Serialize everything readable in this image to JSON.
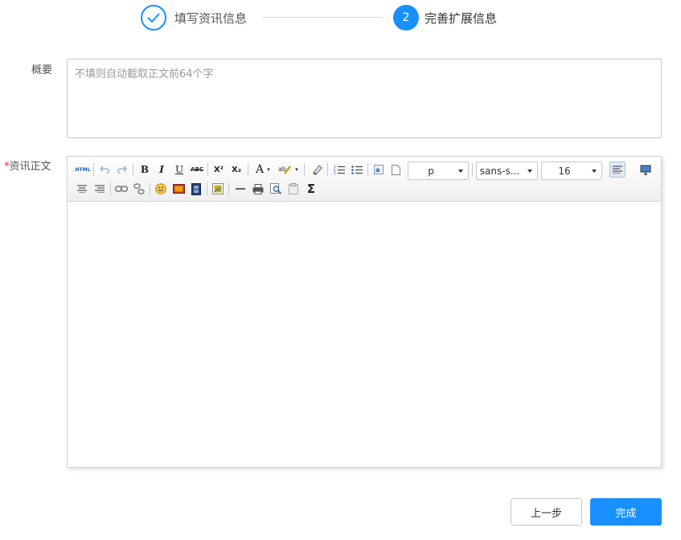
{
  "steps": {
    "step1_label": "填写资讯信息",
    "step2_number": "2",
    "step2_label": "完善扩展信息"
  },
  "form": {
    "summary_label": "概要",
    "summary_placeholder": "不填则自动截取正文前64个字",
    "content_required_mark": "*",
    "content_label": "资讯正文"
  },
  "toolbar": {
    "html_label": "HTML",
    "bold": "B",
    "italic": "I",
    "underline": "U",
    "strike": "ABC",
    "superscript": "X²",
    "subscript": "X₂",
    "font_color": "A",
    "paragraph_value": "p",
    "font_family_value": "sans-s...",
    "font_size_value": "16",
    "formula": "Σ"
  },
  "buttons": {
    "prev": "上一步",
    "done": "完成"
  },
  "colors": {
    "primary": "#1890ff",
    "required": "#f5222d"
  }
}
